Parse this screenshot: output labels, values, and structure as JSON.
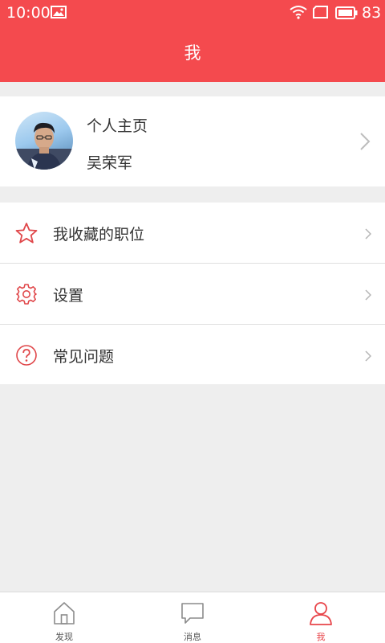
{
  "status_bar": {
    "time": "10:00",
    "battery": "83",
    "icons": [
      "image-icon",
      "wifi-icon",
      "sim-icon",
      "battery-icon"
    ]
  },
  "header": {
    "title": "我"
  },
  "profile": {
    "label": "个人主页",
    "name": "吴荣军"
  },
  "menu": [
    {
      "label": "我收藏的职位",
      "icon": "star-icon"
    },
    {
      "label": "设置",
      "icon": "gear-icon"
    },
    {
      "label": "常见问题",
      "icon": "question-icon"
    }
  ],
  "tabs": [
    {
      "label": "发现",
      "icon": "home-icon",
      "active": false
    },
    {
      "label": "消息",
      "icon": "chat-icon",
      "active": false
    },
    {
      "label": "我",
      "icon": "person-icon",
      "active": true
    }
  ],
  "colors": {
    "brand": "#f44a4e",
    "active_tab": "#e8454a",
    "icon_red": "#e0474a"
  }
}
